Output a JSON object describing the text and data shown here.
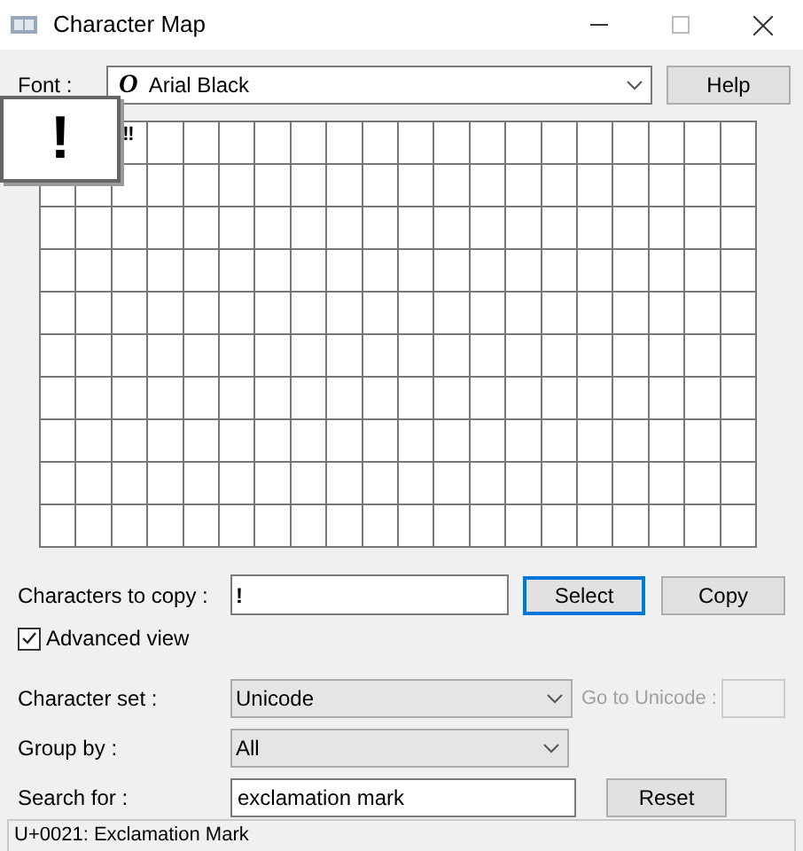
{
  "window": {
    "title": "Character Map"
  },
  "font": {
    "label": "Font :",
    "value": "Arial Black",
    "glyph": "O"
  },
  "help_button": "Help",
  "grid": {
    "zoomed_character": "!",
    "characters": [
      "‼"
    ]
  },
  "copy": {
    "label": "Characters to copy :",
    "value": "!"
  },
  "select_button": {
    "label": "Select",
    "focused": true
  },
  "copy_button": {
    "label": "Copy",
    "focused": false
  },
  "advanced_view": {
    "label": "Advanced view",
    "checked": true
  },
  "character_set": {
    "label": "Character set :",
    "value": "Unicode"
  },
  "go_to_unicode": {
    "label": "Go to Unicode :",
    "disabled": true
  },
  "group_by": {
    "label": "Group by :",
    "value": "All"
  },
  "search": {
    "label": "Search for :",
    "value": "exclamation mark"
  },
  "reset_button": "Reset",
  "status_bar": "U+0021: Exclamation Mark"
}
